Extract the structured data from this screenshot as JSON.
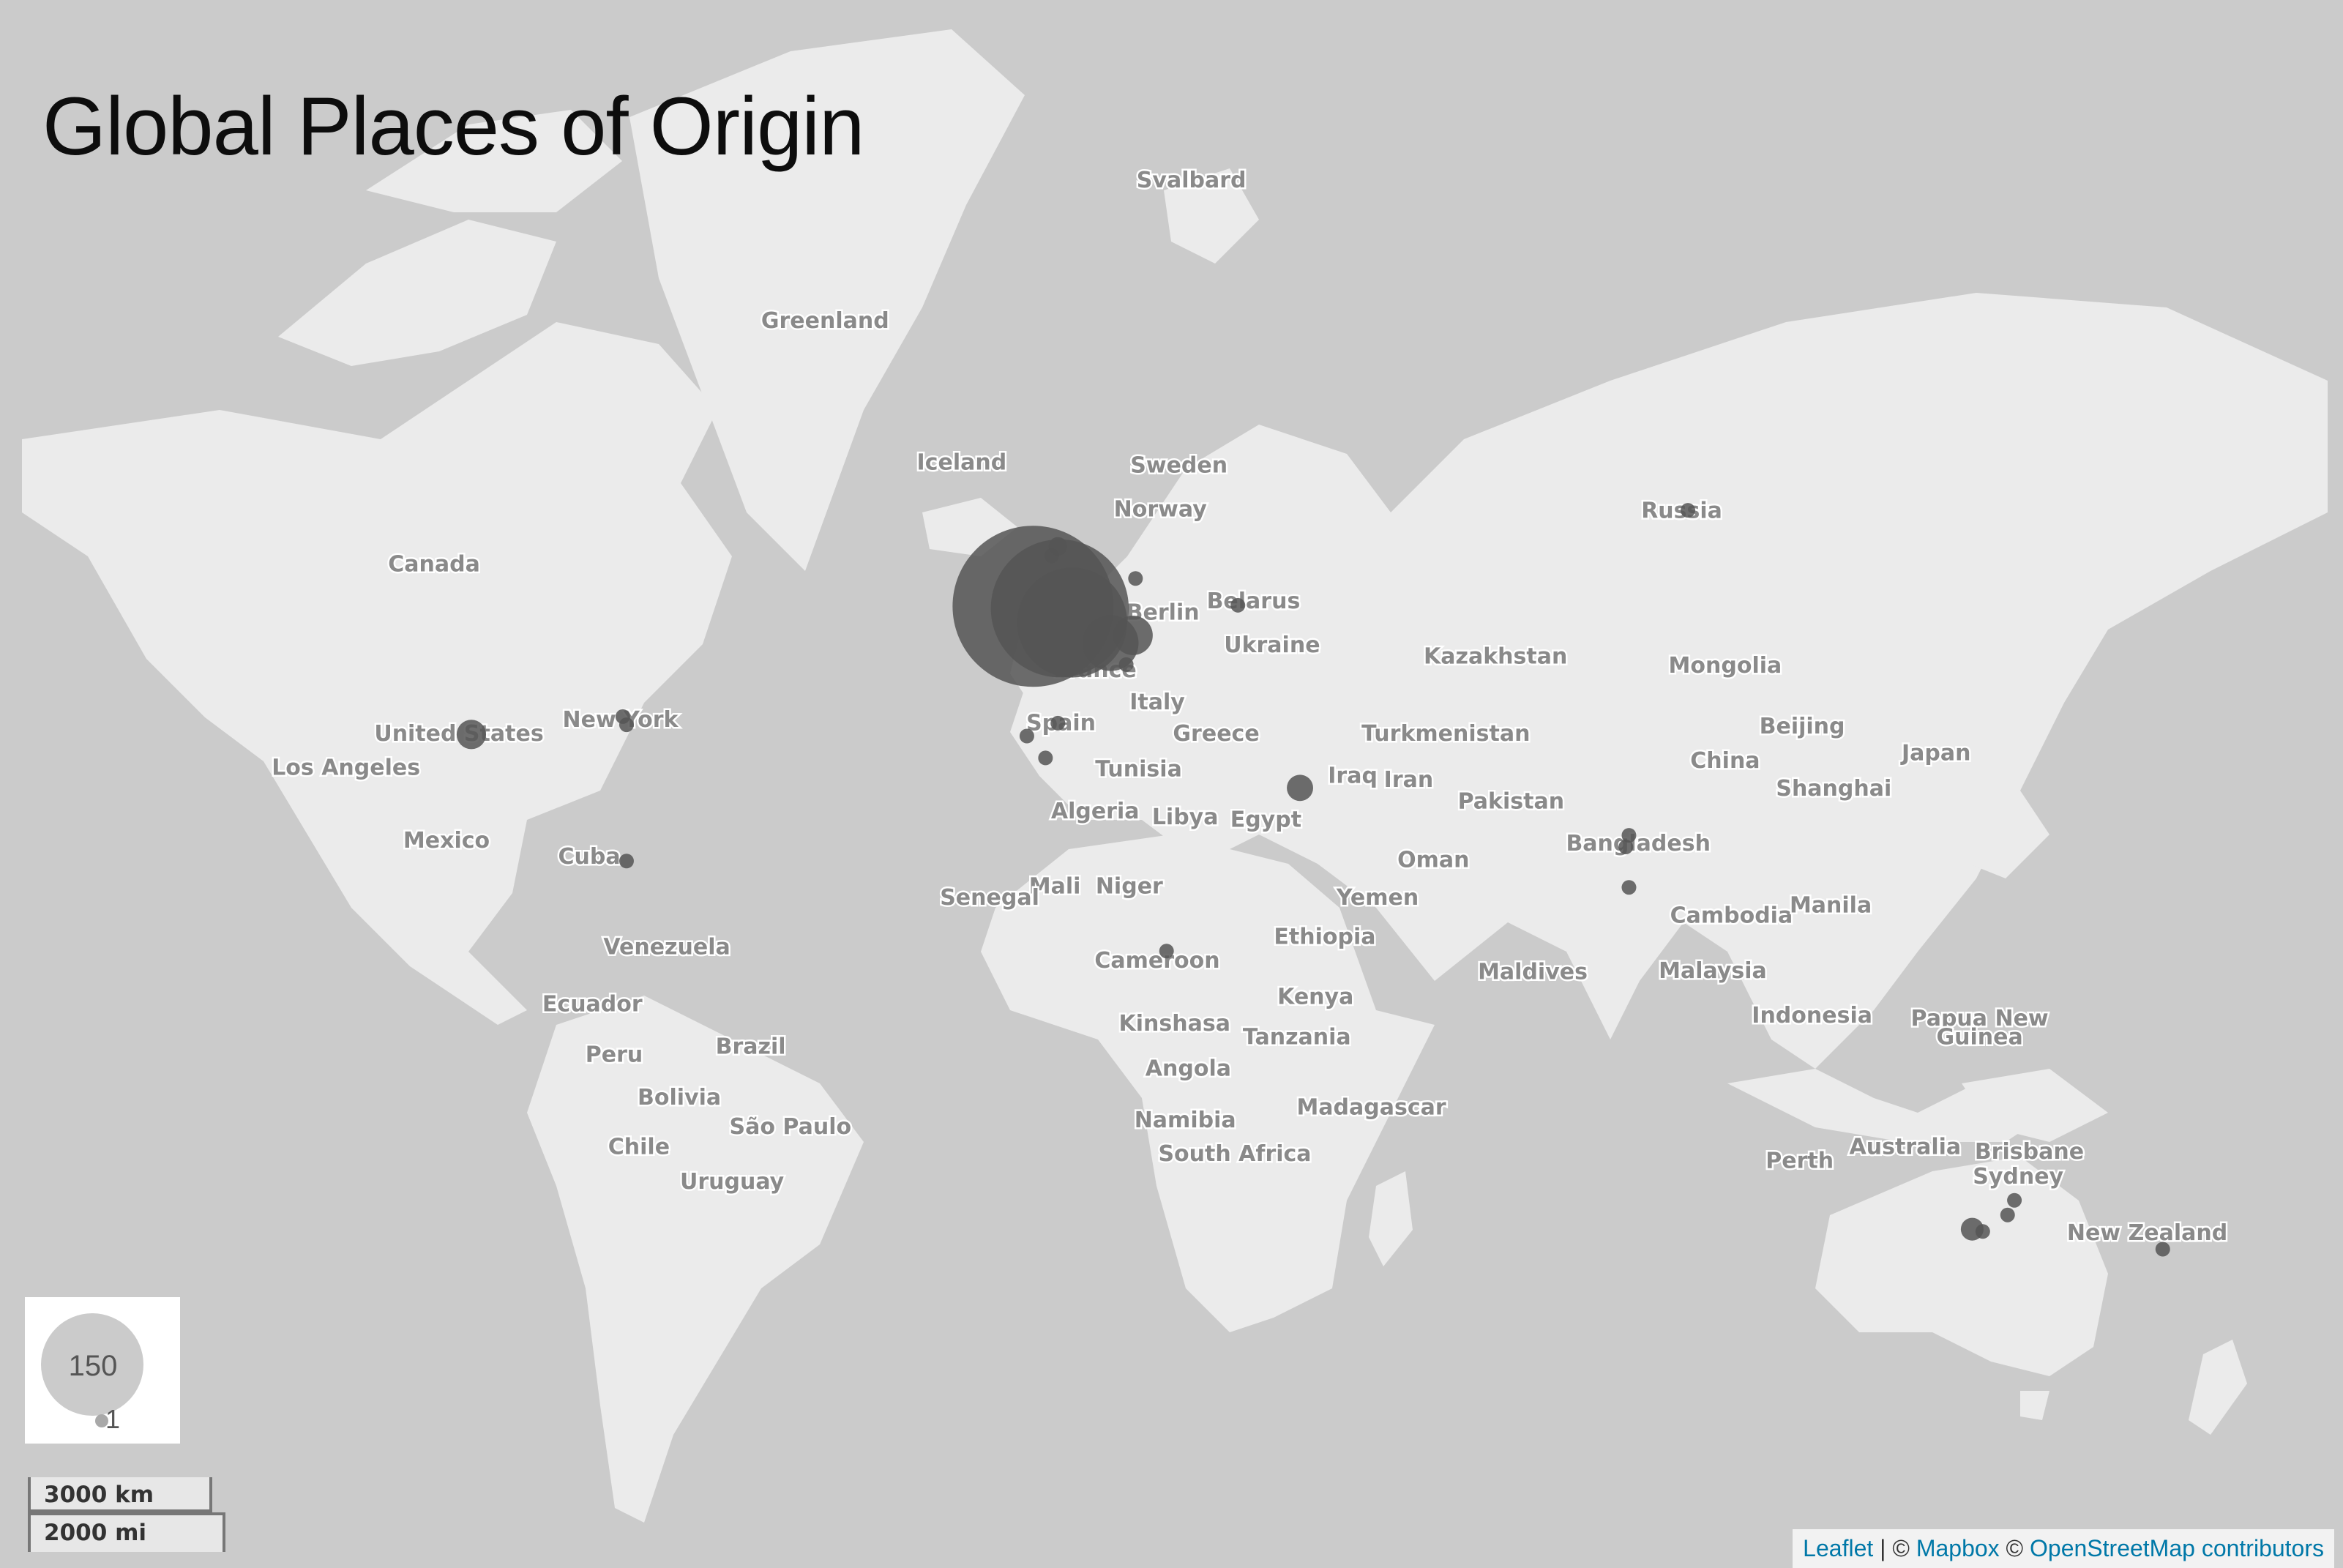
{
  "title": "Global Places of Origin",
  "colors": {
    "water": "#cbcbcb",
    "land": "#ebebeb",
    "bubble": "#555555",
    "label": "#8a8a8a",
    "link": "#0078a8"
  },
  "legend": {
    "max_value": "150",
    "min_value": "1"
  },
  "scale": {
    "km": "3000 km",
    "mi": "2000 mi"
  },
  "attribution": {
    "leaflet": "Leaflet",
    "sep1": " | © ",
    "mapbox": "Mapbox",
    "sep2": " © ",
    "osm": "OpenStreetMap contributors"
  },
  "labels": [
    {
      "text": "Svalbard",
      "lon": 18,
      "lat": 78.5
    },
    {
      "text": "Greenland",
      "lon": -41,
      "lat": 73
    },
    {
      "text": "Iceland",
      "lon": -19,
      "lat": 64.9
    },
    {
      "text": "Sweden",
      "lon": 16,
      "lat": 64.7
    },
    {
      "text": "Norway",
      "lon": 13,
      "lat": 61.5
    },
    {
      "text": "Russia",
      "lon": 97,
      "lat": 61.4
    },
    {
      "text": "Canada",
      "lon": -104,
      "lat": 57
    },
    {
      "text": "Belarus",
      "lon": 28,
      "lat": 53.6
    },
    {
      "text": "Berlin",
      "lon": 13.4,
      "lat": 52.5
    },
    {
      "text": "Ukraine",
      "lon": 31,
      "lat": 49.2
    },
    {
      "text": "France",
      "lon": 2.5,
      "lat": 46.5
    },
    {
      "text": "Kazakhstan",
      "lon": 67,
      "lat": 48
    },
    {
      "text": "Mongolia",
      "lon": 104,
      "lat": 47
    },
    {
      "text": "Italy",
      "lon": 12.5,
      "lat": 42.8
    },
    {
      "text": "Spain",
      "lon": -3,
      "lat": 40.3
    },
    {
      "text": "Greece",
      "lon": 22,
      "lat": 39
    },
    {
      "text": "Turkmenistan",
      "lon": 59,
      "lat": 39
    },
    {
      "text": "United States",
      "lon": -100,
      "lat": 39
    },
    {
      "text": "New York",
      "lon": -74,
      "lat": 40.7
    },
    {
      "text": "Beijing",
      "lon": 116.4,
      "lat": 39.9
    },
    {
      "text": "China",
      "lon": 104,
      "lat": 35.5
    },
    {
      "text": "Japan",
      "lon": 138,
      "lat": 36.5
    },
    {
      "text": "Los Angeles",
      "lon": -118.2,
      "lat": 34.6
    },
    {
      "text": "Tunisia",
      "lon": 9.5,
      "lat": 34.4
    },
    {
      "text": "Iraq",
      "lon": 44,
      "lat": 33.5
    },
    {
      "text": "Iran",
      "lon": 53,
      "lat": 33
    },
    {
      "text": "Shanghai",
      "lon": 121.5,
      "lat": 31.8
    },
    {
      "text": "Pakistan",
      "lon": 69.5,
      "lat": 30
    },
    {
      "text": "Algeria",
      "lon": 2.5,
      "lat": 28.6
    },
    {
      "text": "Libya",
      "lon": 17,
      "lat": 27.8
    },
    {
      "text": "Egypt",
      "lon": 30,
      "lat": 27.4
    },
    {
      "text": "Mexico",
      "lon": -102,
      "lat": 24.4
    },
    {
      "text": "Bangladesh",
      "lon": 90,
      "lat": 24
    },
    {
      "text": "Cuba",
      "lon": -79,
      "lat": 22
    },
    {
      "text": "Oman",
      "lon": 57,
      "lat": 21.5
    },
    {
      "text": "Yemen",
      "lon": 48,
      "lat": 15.8
    },
    {
      "text": "Mali",
      "lon": -4,
      "lat": 17.5
    },
    {
      "text": "Niger",
      "lon": 8,
      "lat": 17.5
    },
    {
      "text": "Senegal",
      "lon": -14.5,
      "lat": 15.8
    },
    {
      "text": "Cambodia",
      "lon": 105,
      "lat": 13
    },
    {
      "text": "Manila",
      "lon": 121,
      "lat": 14.6
    },
    {
      "text": "Ethiopia",
      "lon": 39.5,
      "lat": 9.6
    },
    {
      "text": "Venezuela",
      "lon": -66.5,
      "lat": 8
    },
    {
      "text": "Cameroon",
      "lon": 12.5,
      "lat": 5.8
    },
    {
      "text": "Maldives",
      "lon": 73,
      "lat": 4
    },
    {
      "text": "Malaysia",
      "lon": 102,
      "lat": 4.2
    },
    {
      "text": "Ecuador",
      "lon": -78.5,
      "lat": -1.2
    },
    {
      "text": "Kenya",
      "lon": 38,
      "lat": 0
    },
    {
      "text": "Indonesia",
      "lon": 118,
      "lat": -3
    },
    {
      "text": "Papua New",
      "lon": 145,
      "lat": -3.5
    },
    {
      "text": "Guinea",
      "lon": 145,
      "lat": -6.5
    },
    {
      "text": "Kinshasa",
      "lon": 15.3,
      "lat": -4.3
    },
    {
      "text": "Tanzania",
      "lon": 35,
      "lat": -6.5
    },
    {
      "text": "Peru",
      "lon": -75,
      "lat": -9.3
    },
    {
      "text": "Brazil",
      "lon": -53,
      "lat": -8
    },
    {
      "text": "Angola",
      "lon": 17.5,
      "lat": -11.5
    },
    {
      "text": "Bolivia",
      "lon": -64.5,
      "lat": -16
    },
    {
      "text": "Namibia",
      "lon": 17,
      "lat": -19.5
    },
    {
      "text": "Madagascar",
      "lon": 47,
      "lat": -17.5
    },
    {
      "text": "São Paulo",
      "lon": -46.6,
      "lat": -20.5
    },
    {
      "text": "Chile",
      "lon": -71,
      "lat": -23.5
    },
    {
      "text": "South Africa",
      "lon": 25,
      "lat": -24.5
    },
    {
      "text": "Australia",
      "lon": 133,
      "lat": -23.5
    },
    {
      "text": "Brisbane",
      "lon": 153,
      "lat": -24.2
    },
    {
      "text": "Perth",
      "lon": 116,
      "lat": -25.5
    },
    {
      "text": "Uruguay",
      "lon": -56,
      "lat": -28.5
    },
    {
      "text": "Sydney",
      "lon": 151.2,
      "lat": -27.8
    },
    {
      "text": "New Zealand",
      "lon": 172,
      "lat": -35.5
    }
  ],
  "origins": [
    {
      "lon": -7.5,
      "lat": 53.2,
      "value": 150
    },
    {
      "lon": -3.2,
      "lat": 53.0,
      "value": 110
    },
    {
      "lon": -1.2,
      "lat": 51.6,
      "value": 70
    },
    {
      "lon": 5.0,
      "lat": 49.5,
      "value": 18
    },
    {
      "lon": 8.6,
      "lat": 50.3,
      "value": 9
    },
    {
      "lon": -3.5,
      "lat": 58.6,
      "value": 2
    },
    {
      "lon": -4.5,
      "lat": 57.8,
      "value": 1
    },
    {
      "lon": 9.0,
      "lat": 55.8,
      "value": 1
    },
    {
      "lon": 25.5,
      "lat": 53.3,
      "value": 1
    },
    {
      "lon": 7.5,
      "lat": 47.2,
      "value": 1
    },
    {
      "lon": -3.5,
      "lat": 40.4,
      "value": 1
    },
    {
      "lon": -8.5,
      "lat": 38.8,
      "value": 1
    },
    {
      "lon": -5.5,
      "lat": 36.0,
      "value": 1
    },
    {
      "lon": -98,
      "lat": 39,
      "value": 5
    },
    {
      "lon": -73.6,
      "lat": 41.2,
      "value": 1
    },
    {
      "lon": -73.0,
      "lat": 40.2,
      "value": 1
    },
    {
      "lon": -73,
      "lat": 21.5,
      "value": 1
    },
    {
      "lon": 35.5,
      "lat": 32.0,
      "value": 4
    },
    {
      "lon": 88.5,
      "lat": 25.3,
      "value": 1
    },
    {
      "lon": 88.0,
      "lat": 23.6,
      "value": 1
    },
    {
      "lon": 88.5,
      "lat": 17.5,
      "value": 1
    },
    {
      "lon": 98,
      "lat": 61.5,
      "value": 1
    },
    {
      "lon": 14,
      "lat": 7.5,
      "value": 1
    },
    {
      "lon": 143.8,
      "lat": -34.9,
      "value": 3
    },
    {
      "lon": 145.5,
      "lat": -35.2,
      "value": 1
    },
    {
      "lon": 149.5,
      "lat": -33.0,
      "value": 1
    },
    {
      "lon": 150.6,
      "lat": -31.0,
      "value": 1
    },
    {
      "lon": 174.5,
      "lat": -37.5,
      "value": 1
    }
  ]
}
